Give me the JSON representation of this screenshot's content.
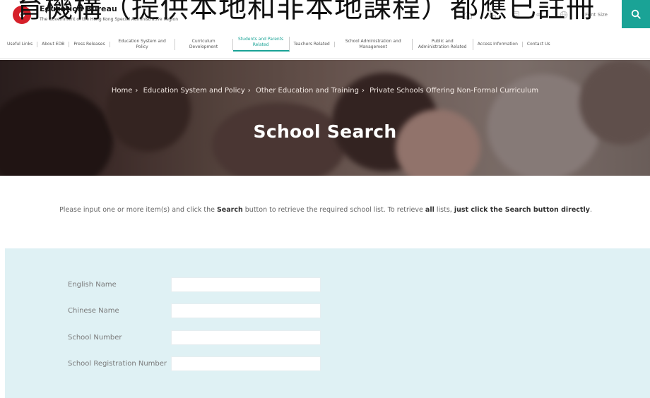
{
  "overlay": {
    "title": "育機構（提供本地和非本地課程）都應已註冊"
  },
  "header": {
    "brand_name": "Education Bureau",
    "brand_sub": "The Government of the Hong Kong Special Administrative Region",
    "font_size_label": "Font Size"
  },
  "nav": {
    "items": [
      {
        "label": "Useful Links"
      },
      {
        "label": "About EDB"
      },
      {
        "label": "Press Releases"
      },
      {
        "label": "Education System and Policy"
      },
      {
        "label": "Curriculum Development"
      },
      {
        "label": "Students and Parents Related"
      },
      {
        "label": "Teachers Related"
      },
      {
        "label": "School Administration and Management"
      },
      {
        "label": "Public and Administration Related"
      },
      {
        "label": "Access Information"
      },
      {
        "label": "Contact Us"
      }
    ]
  },
  "hero": {
    "breadcrumb": [
      "Home",
      "Education System and Policy",
      "Other Education and Training",
      "Private Schools Offering Non-Formal Curriculum"
    ],
    "title": "School Search"
  },
  "instructions": {
    "part1": "Please input one or more item(s) and click the ",
    "search_bold": "Search",
    "part2": " button to retrieve the required school list. To retrieve ",
    "all_bold": "all",
    "part3": " lists, ",
    "tail_bold": "just click the Search button directly",
    "part4": "."
  },
  "form": {
    "fields": [
      {
        "label": "English Name",
        "value": ""
      },
      {
        "label": "Chinese Name",
        "value": ""
      },
      {
        "label": "School Number",
        "value": ""
      },
      {
        "label": "School Registration Number",
        "value": ""
      }
    ]
  },
  "colors": {
    "accent": "#1aa396",
    "brand_red": "#d6202a",
    "form_bg": "#dff1f4"
  }
}
